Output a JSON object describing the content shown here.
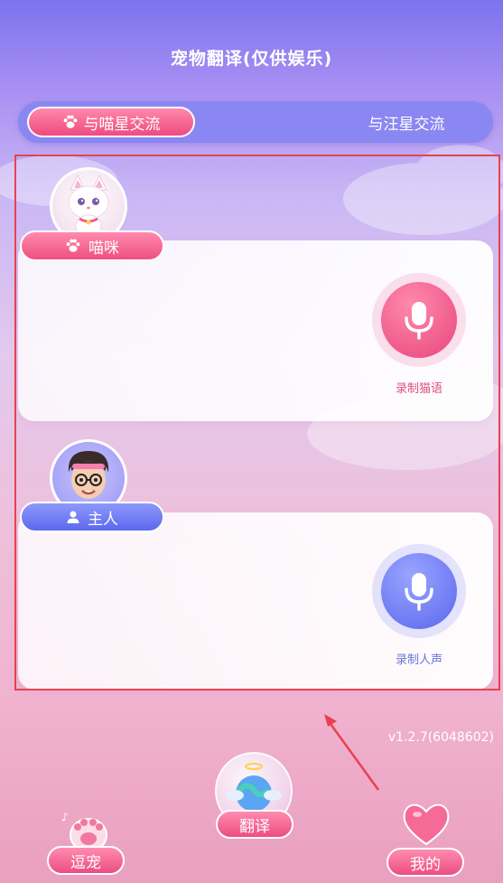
{
  "header": {
    "title": "宠物翻译(仅供娱乐)"
  },
  "tabs": [
    {
      "label": "与喵星交流",
      "active": true
    },
    {
      "label": "与汪星交流",
      "active": false
    }
  ],
  "cat_panel": {
    "name": "喵咪",
    "record_label": "录制猫语",
    "accent": "#ee4b80"
  },
  "owner_panel": {
    "name": "主人",
    "record_label": "录制人声",
    "accent": "#5d68ee"
  },
  "version": "v1.2.7(6048602)",
  "bottom_nav": [
    {
      "label": "逗宠",
      "icon": "paw-icon"
    },
    {
      "label": "翻译",
      "icon": "globe-icon"
    },
    {
      "label": "我的",
      "icon": "heart-icon"
    }
  ]
}
